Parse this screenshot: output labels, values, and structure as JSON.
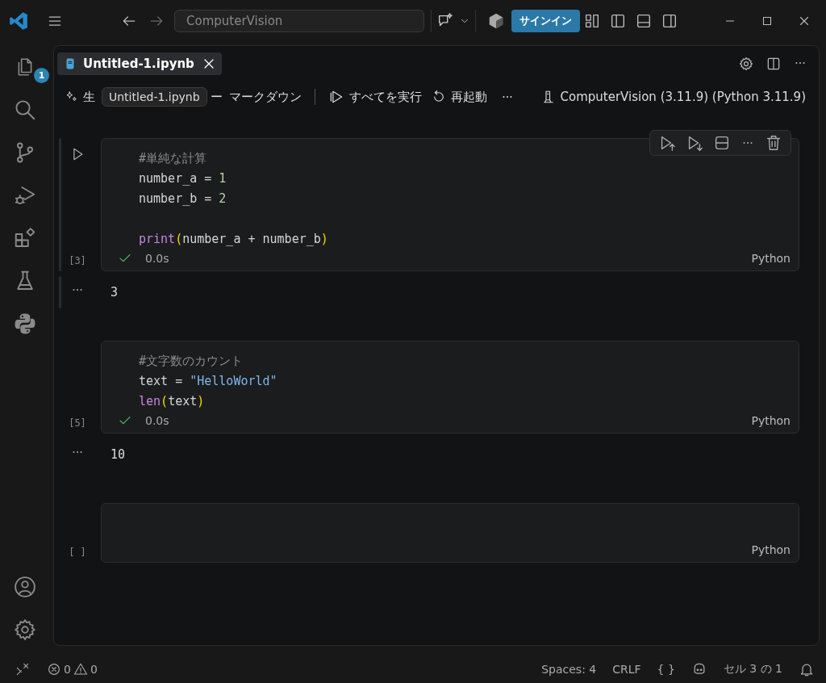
{
  "title_bar": {
    "search": "ComputerVision",
    "sign_in": "サインイン"
  },
  "activity_bar": {
    "badge": "1",
    "items": [
      {
        "kind": "explorer"
      },
      {
        "kind": "search"
      },
      {
        "kind": "source-control"
      },
      {
        "kind": "run-debug"
      },
      {
        "kind": "extensions"
      },
      {
        "kind": "testing"
      },
      {
        "kind": "python"
      }
    ],
    "bottom": [
      {
        "kind": "account"
      },
      {
        "kind": "settings"
      }
    ]
  },
  "tab": {
    "label": "Untitled-1.ipynb"
  },
  "toolbar": {
    "items": [
      {
        "kind": "generate",
        "label": "生"
      },
      {
        "kind": "tooltip",
        "label": "Untitled-1.ipynb"
      },
      {
        "kind": "text",
        "label": "ー"
      },
      {
        "kind": "markdown",
        "label": "マークダウン"
      },
      {
        "kind": "run-all",
        "label": "すべてを実行"
      },
      {
        "kind": "restart",
        "label": "再起動"
      },
      {
        "kind": "more"
      }
    ],
    "kernel": "ComputerVision (3.11.9) (Python 3.11.9)"
  },
  "cells": [
    {
      "focused": true,
      "execution_count": "[3]",
      "succeeded": true,
      "time": "0.0s",
      "language": "Python",
      "output": "3",
      "lines": [
        [
          {
            "text": "#単純な計算",
            "kind": "comment"
          }
        ],
        [
          {
            "text": "number_a = ",
            "kind": "plain"
          },
          {
            "text": "1",
            "kind": "number"
          }
        ],
        [
          {
            "text": "number_b = ",
            "kind": "plain"
          },
          {
            "text": "2",
            "kind": "number"
          }
        ],
        [
          {
            "text": "print",
            "kind": "function",
            "blank_line_before": true
          },
          {
            "text": "(",
            "kind": "paren"
          },
          {
            "text": "number_a + number_b",
            "kind": "plain"
          },
          {
            "text": ")",
            "kind": "paren"
          }
        ]
      ]
    },
    {
      "focused": false,
      "execution_count": "[5]",
      "succeeded": true,
      "time": "0.0s",
      "language": "Python",
      "output": "10",
      "lines": [
        [
          {
            "text": "#文字数のカウント",
            "kind": "comment"
          }
        ],
        [
          {
            "text": "text = ",
            "kind": "plain"
          },
          {
            "text": "\"HelloWorld\"",
            "kind": "string"
          }
        ],
        [
          {
            "text": "len",
            "kind": "function"
          },
          {
            "text": "(",
            "kind": "paren"
          },
          {
            "text": "text",
            "kind": "plain"
          },
          {
            "text": ")",
            "kind": "paren"
          }
        ]
      ]
    },
    {
      "focused": false,
      "execution_count": "[ ]",
      "succeeded": false,
      "language": "Python"
    }
  ],
  "status_bar": {
    "errors": "0",
    "warnings": "0",
    "right": [
      {
        "kind": "text",
        "label": "Spaces: 4"
      },
      {
        "kind": "text",
        "label": "CRLF"
      },
      {
        "kind": "text",
        "label": "{ }"
      },
      {
        "kind": "copilot"
      },
      {
        "kind": "text",
        "label": "セル 3 の 1"
      },
      {
        "kind": "bell"
      }
    ]
  }
}
